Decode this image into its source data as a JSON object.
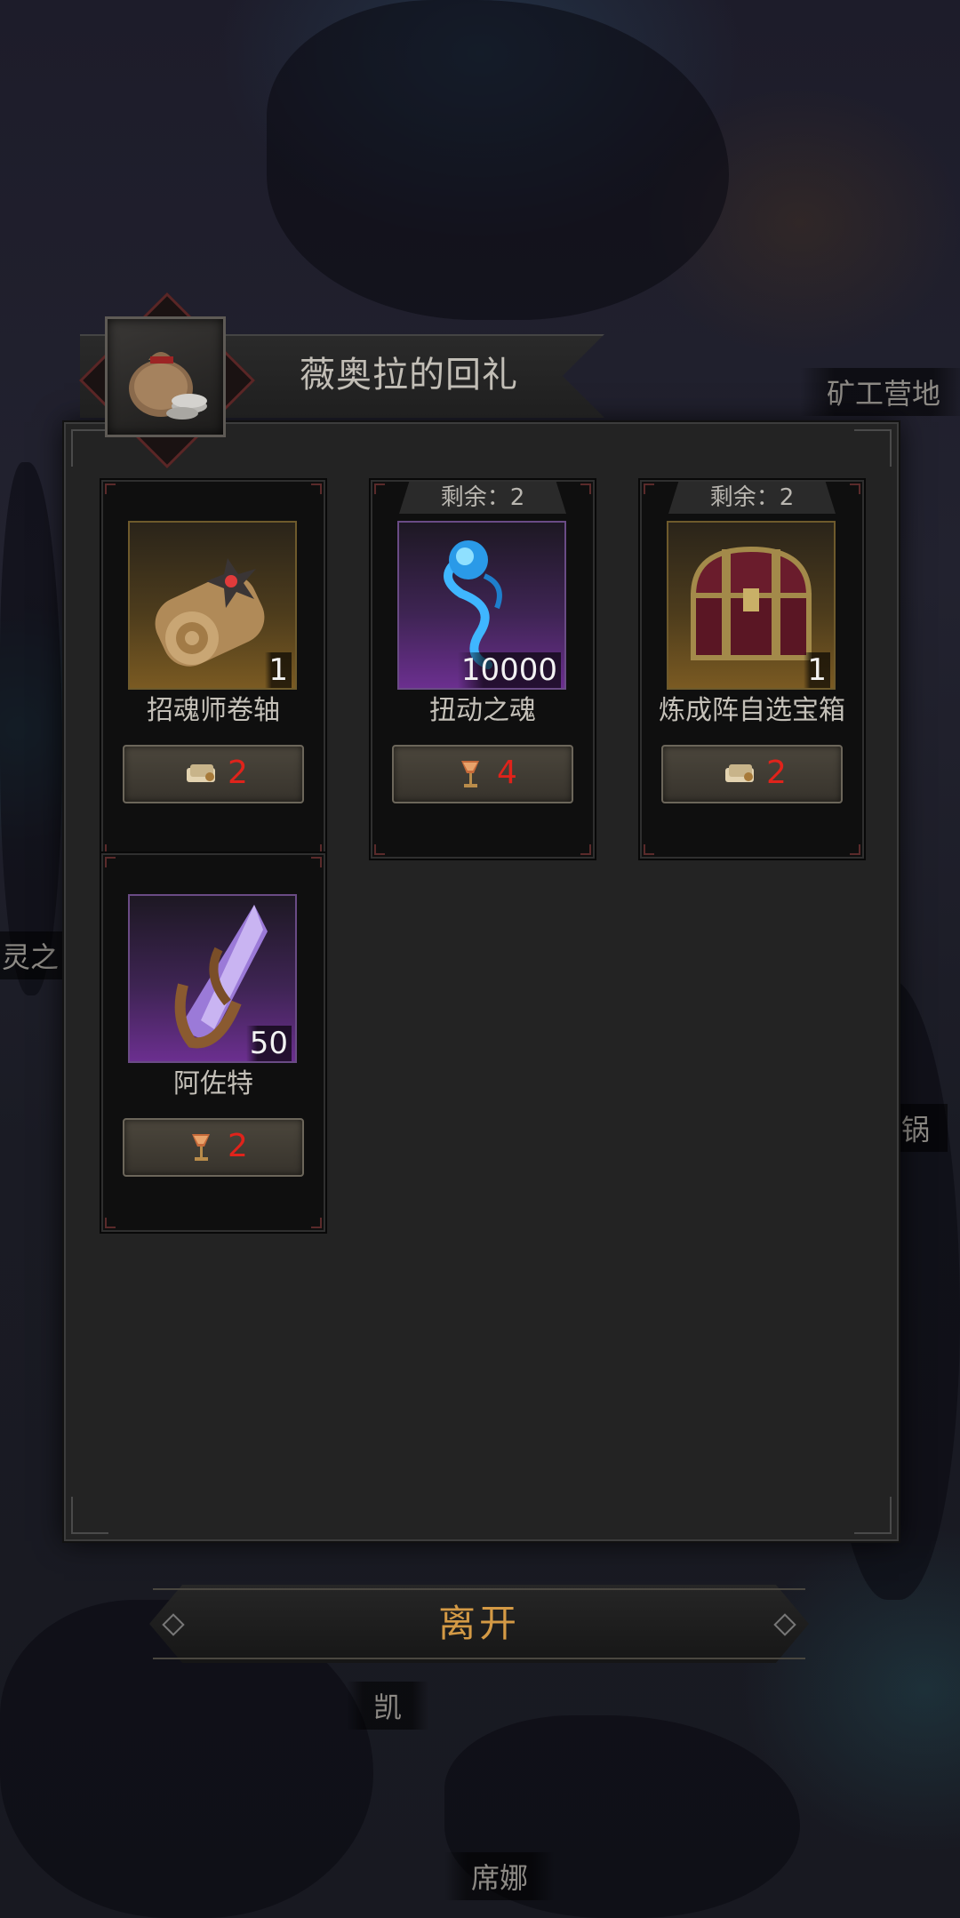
{
  "dialog": {
    "title": "薇奥拉的回礼",
    "title_icon": "coin-bag-icon"
  },
  "map_labels": {
    "miner_camp": "矿工营地",
    "left_partial": "灵之",
    "right_partial": "锅",
    "npc_kai": "凯",
    "npc_xina": "席娜"
  },
  "items": [
    {
      "name": "招魂师卷轴",
      "quantity": "1",
      "remaining": "",
      "icon": "scroll-icon",
      "rarity_color": "#7a5a22",
      "cost": "2",
      "cost_icon": "ticket-icon"
    },
    {
      "name": "扭动之魂",
      "quantity": "10000",
      "remaining": "剩余：2",
      "icon": "blue-soul-icon",
      "rarity_color": "#6b2f8f",
      "cost": "4",
      "cost_icon": "chalice-icon"
    },
    {
      "name": "炼成阵自选宝箱",
      "quantity": "1",
      "remaining": "剩余：2",
      "icon": "treasure-chest-icon",
      "rarity_color": "#7a5a22",
      "cost": "2",
      "cost_icon": "ticket-icon"
    },
    {
      "name": "阿佐特",
      "quantity": "50",
      "remaining": "",
      "icon": "purple-crystal-icon",
      "rarity_color": "#6b2f8f",
      "cost": "2",
      "cost_icon": "chalice-icon"
    }
  ],
  "leave_button": {
    "label": "离开"
  },
  "colors": {
    "cost_text": "#e0231b",
    "leave_text": "#d49a45",
    "panel_bg": "#232323"
  }
}
